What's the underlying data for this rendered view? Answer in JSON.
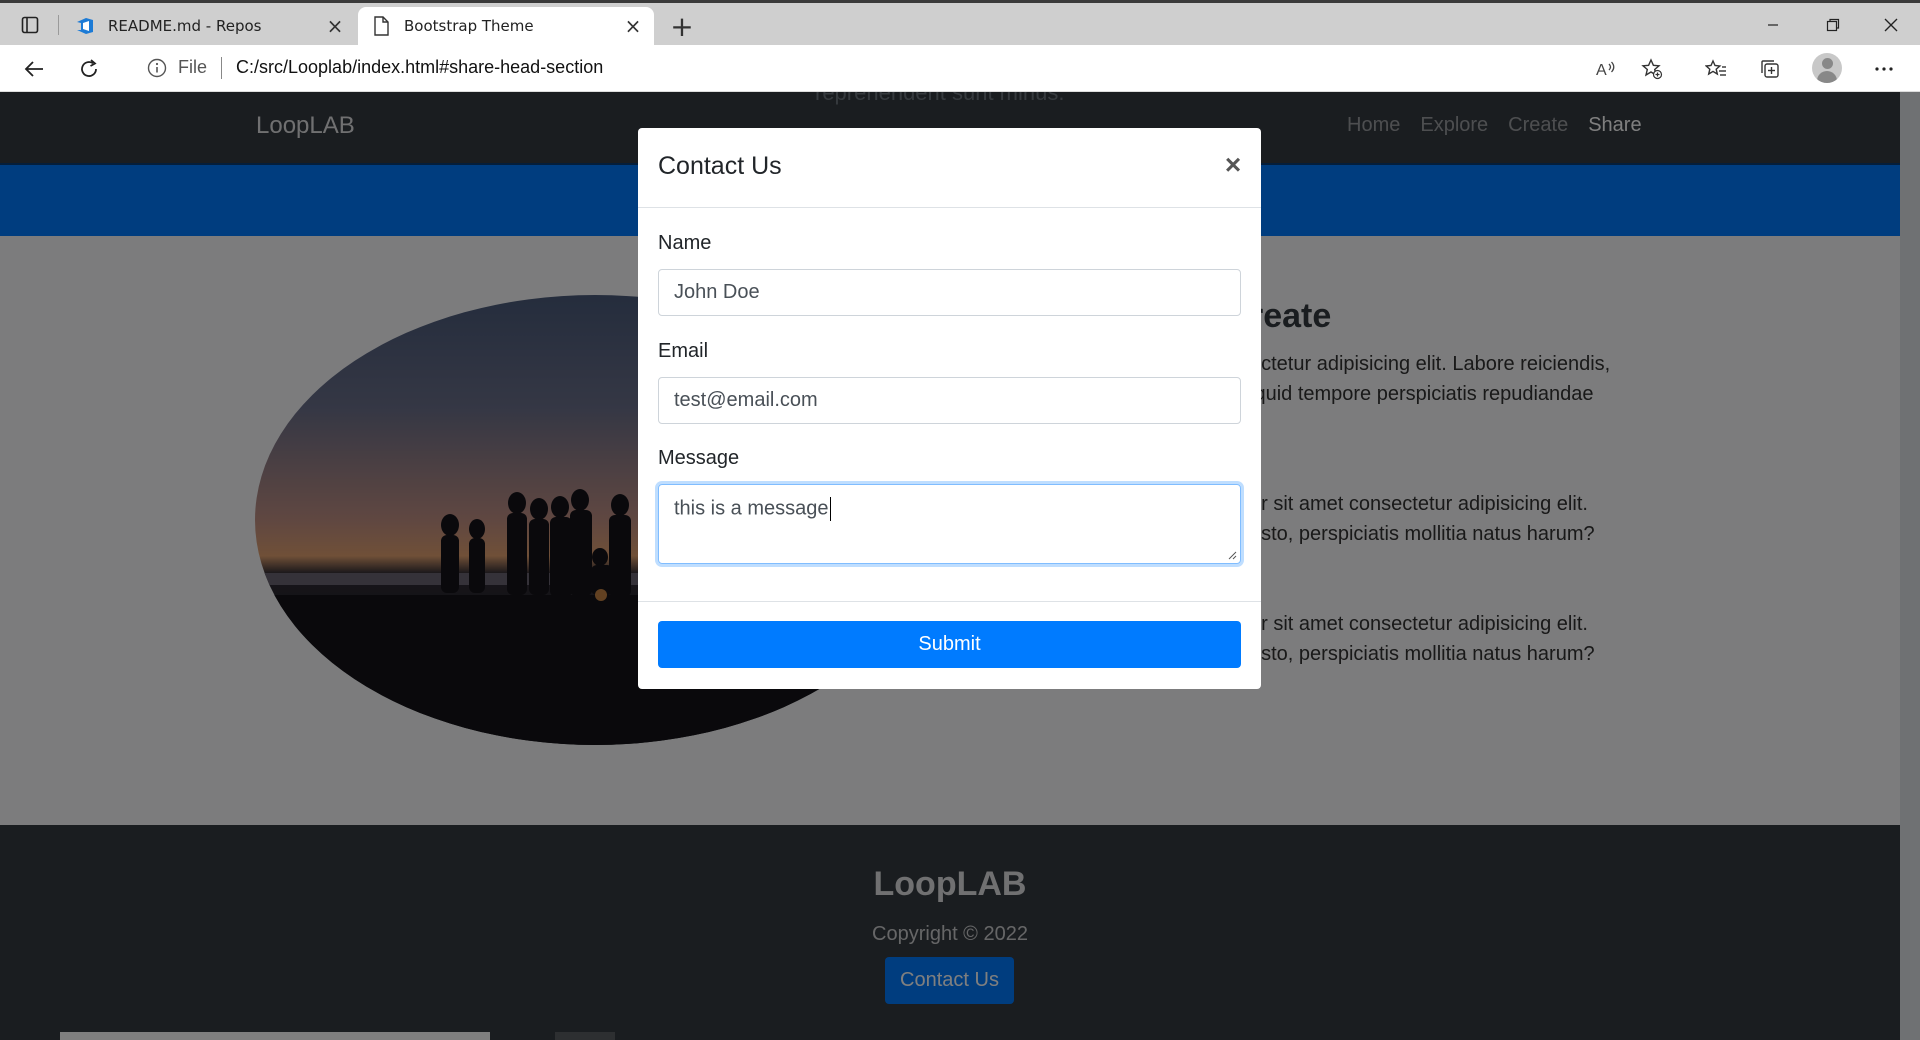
{
  "browser": {
    "tabs": [
      {
        "title": "README.md - Repos",
        "icon": "azure-devops-icon",
        "active": false
      },
      {
        "title": "Bootstrap Theme",
        "icon": "page-icon",
        "active": true
      }
    ],
    "address": {
      "file_label": "File",
      "url": "C:/src/Looplab/index.html#share-head-section"
    }
  },
  "page": {
    "ghost_text": "reprehenderit sunt minus.",
    "navbar": {
      "brand": "LoopLAB",
      "links": [
        "Home",
        "Explore",
        "Create",
        "Share"
      ],
      "active_link": "Share"
    },
    "section": {
      "title_fragment": "reate",
      "paragraphs": [
        {
          "line1": "ectetur adipisicing elit. Labore reiciendis,",
          "line2": "iquid tempore perspiciatis repudiandae"
        },
        {
          "line1": "or sit amet consectetur adipisicing elit.",
          "line2": "usto, perspiciatis mollitia natus harum?"
        },
        {
          "line1": "or sit amet consectetur adipisicing elit.",
          "line2": "usto, perspiciatis mollitia natus harum?"
        }
      ]
    },
    "footer": {
      "brand": "LoopLAB",
      "copyright": "Copyright © 2022",
      "contact_button": "Contact Us"
    }
  },
  "modal": {
    "title": "Contact Us",
    "close_symbol": "×",
    "fields": {
      "name": {
        "label": "Name",
        "value": "John Doe"
      },
      "email": {
        "label": "Email",
        "value": "test@email.com"
      },
      "message": {
        "label": "Message",
        "value": "this is a message"
      }
    },
    "submit_label": "Submit"
  },
  "colors": {
    "primary": "#007bff",
    "dark": "#343a40",
    "backdrop": "rgba(0,0,0,0.5)"
  }
}
